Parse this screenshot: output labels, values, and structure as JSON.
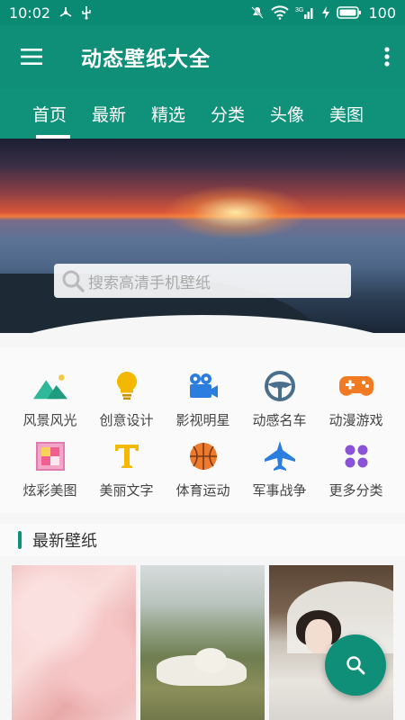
{
  "status": {
    "time": "10:02",
    "battery": "100",
    "network": "3G"
  },
  "app": {
    "title": "动态壁纸大全"
  },
  "tabs": [
    {
      "label": "首页",
      "active": true
    },
    {
      "label": "最新",
      "active": false
    },
    {
      "label": "精选",
      "active": false
    },
    {
      "label": "分类",
      "active": false
    },
    {
      "label": "头像",
      "active": false
    },
    {
      "label": "美图",
      "active": false
    }
  ],
  "search": {
    "placeholder": "搜索高清手机壁纸"
  },
  "categories": [
    {
      "label": "风景风光",
      "icon": "mountain-icon"
    },
    {
      "label": "创意设计",
      "icon": "lightbulb-icon"
    },
    {
      "label": "影视明星",
      "icon": "movie-camera-icon"
    },
    {
      "label": "动感名车",
      "icon": "steering-wheel-icon"
    },
    {
      "label": "动漫游戏",
      "icon": "gamepad-icon"
    },
    {
      "label": "炫彩美图",
      "icon": "colorful-image-icon"
    },
    {
      "label": "美丽文字",
      "icon": "letter-t-icon"
    },
    {
      "label": "体育运动",
      "icon": "basketball-icon"
    },
    {
      "label": "军事战争",
      "icon": "fighter-jet-icon"
    },
    {
      "label": "更多分类",
      "icon": "more-dots-icon"
    }
  ],
  "latest": {
    "title": "最新壁纸"
  },
  "colors": {
    "primary": "#10917a",
    "status": "#0a8a72"
  }
}
